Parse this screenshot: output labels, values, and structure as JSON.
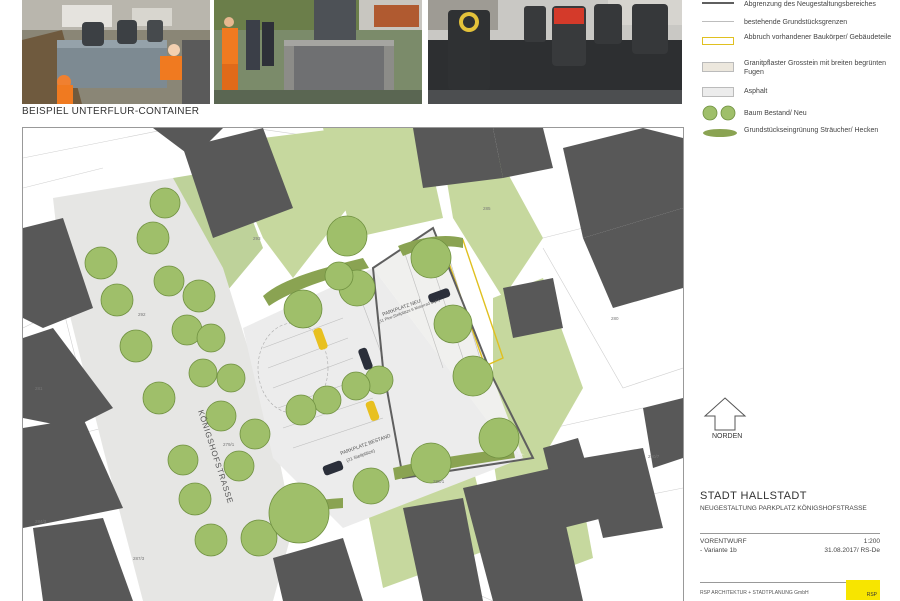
{
  "caption": "BEISPIEL UNTERFLUR-CONTAINER",
  "legend": [
    {
      "symbol": "dark-line",
      "label": "Abgrenzung des Neugestaltungsbereiches"
    },
    {
      "symbol": "thin-line",
      "label": "bestehende Grundstücksgrenzen"
    },
    {
      "symbol": "yellow-outline",
      "label": "Abbruch vorhandener Baukörper/ Gebäudeteile"
    },
    {
      "symbol": "beige-box",
      "label": "Granitpflaster Grosstein mit breiten begrünten Fugen"
    },
    {
      "symbol": "grey-box",
      "label": "Asphalt"
    },
    {
      "symbol": "trees",
      "label": "Baum Bestand/ Neu"
    },
    {
      "symbol": "hedge",
      "label": "Grundstückseingrünung Sträucher/ Hecken"
    }
  ],
  "north_label": "NORDEN",
  "title": "STADT HALLSTADT",
  "subtitle": "NEUGESTALTUNG PARKPLATZ KÖNIGSHOFSTRASSE",
  "meta": {
    "stage": "VORENTWURF",
    "scale": "1:200",
    "variant": "- Variante 1b",
    "date": "31.08.2017/ RS-De"
  },
  "firm": "RSP ARCHITEKTUR + STADTPLANUNG GmbH",
  "logo": "RSP",
  "plan": {
    "street": "KÖNIGSHOFSTRASSE",
    "parking_existing": "PARKPLATZ BESTAND",
    "parking_existing_sub": "(21 Stellplätze)",
    "parking_new": "PARKPLATZ NEU",
    "parking_new_sub": "(11 Pkw-Stellplätze 6 Motorrad Stpl.)",
    "lot_numbers": [
      "293",
      "285",
      "292",
      "280",
      "279/1",
      "281",
      "287/3",
      "288/1",
      "284/3",
      "290/7"
    ]
  },
  "colors": {
    "building": "#585858",
    "lawn": "#c8d8a0",
    "pavement": "#e8e8e6",
    "asphalt": "#ececec",
    "tree": "#9fbf6a",
    "hedge": "#8ba454",
    "boundary": "#606060",
    "logo": "#f7e500"
  }
}
